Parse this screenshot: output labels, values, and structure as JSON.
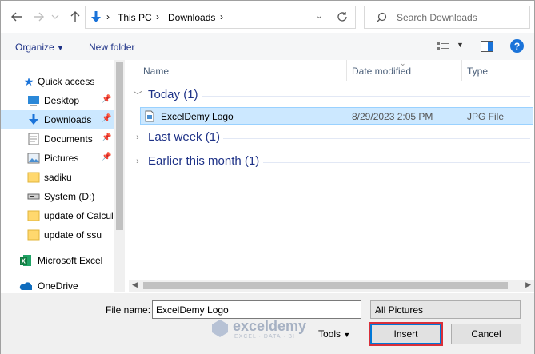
{
  "address": {
    "crumbs": [
      "This PC",
      "Downloads"
    ],
    "search_placeholder": "Search Downloads"
  },
  "toolbar": {
    "organize_label": "Organize",
    "new_folder_label": "New folder"
  },
  "sidebar": {
    "items": [
      {
        "label": "Quick access",
        "icon": "star-icon"
      },
      {
        "label": "Desktop",
        "icon": "desktop-icon",
        "pinned": true
      },
      {
        "label": "Downloads",
        "icon": "download-icon",
        "pinned": true,
        "selected": true
      },
      {
        "label": "Documents",
        "icon": "documents-icon",
        "pinned": true
      },
      {
        "label": "Pictures",
        "icon": "pictures-icon",
        "pinned": true
      },
      {
        "label": "sadiku",
        "icon": "folder-icon"
      },
      {
        "label": "System (D:)",
        "icon": "drive-icon"
      },
      {
        "label": "update of Calcul",
        "icon": "folder-icon"
      },
      {
        "label": "update of ssu",
        "icon": "folder-icon"
      },
      {
        "label": "Microsoft Excel",
        "icon": "excel-icon"
      },
      {
        "label": "OneDrive",
        "icon": "onedrive-icon"
      }
    ]
  },
  "columns": {
    "name": "Name",
    "date_modified": "Date modified",
    "type": "Type"
  },
  "groups": {
    "today": "Today (1)",
    "last_week": "Last week (1)",
    "earlier": "Earlier this month (1)"
  },
  "file": {
    "name": "ExcelDemy Logo",
    "date": "8/29/2023 2:05 PM",
    "type": "JPG File"
  },
  "bottom": {
    "file_name_label": "File name:",
    "file_name_value": "ExcelDemy Logo",
    "filter_value": "All Pictures",
    "tools_label": "Tools",
    "insert_label": "Insert",
    "cancel_label": "Cancel",
    "watermark_text": "exceldemy",
    "watermark_sub": "EXCEL · DATA · BI"
  },
  "colors": {
    "accent": "#0078d7",
    "selection": "#cce8ff",
    "link_blue": "#1e3287",
    "insert_highlight": "#d9303a"
  }
}
